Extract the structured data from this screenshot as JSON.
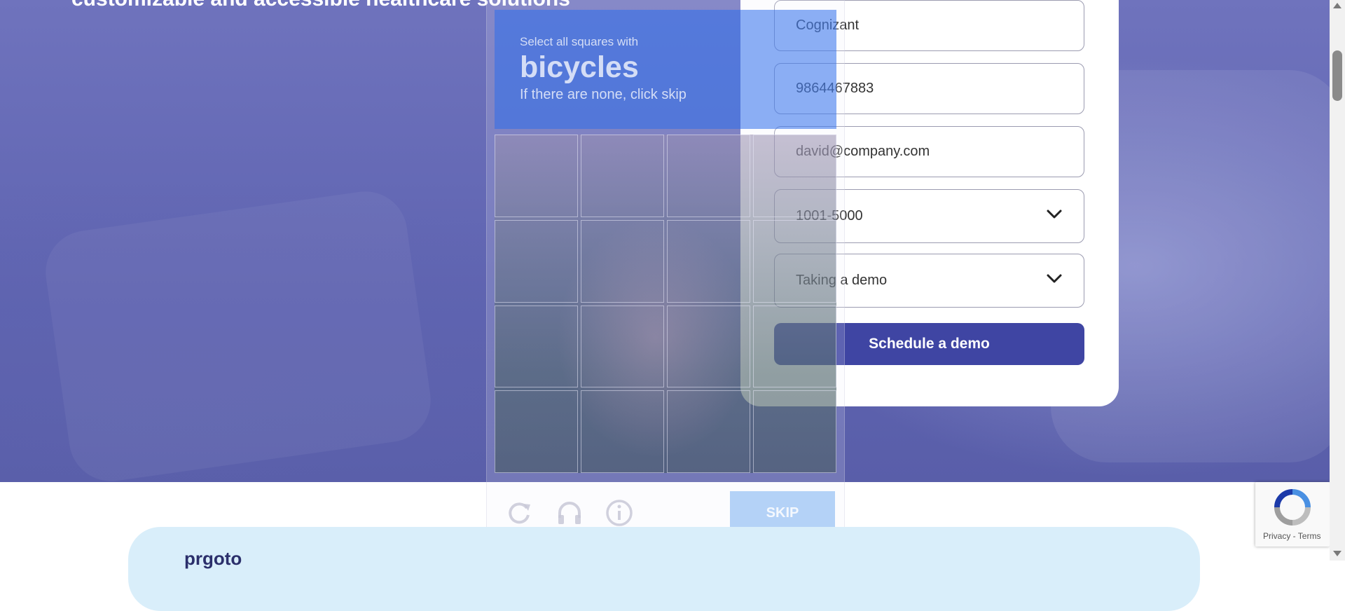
{
  "hero": {
    "title": "customizable and accessible healthcare solutions"
  },
  "form": {
    "company_value": "Cognizant",
    "phone_value": "9864467883",
    "email_value": "david@company.com",
    "company_size_selected": "1001-5000",
    "interest_selected": "Taking a demo",
    "submit_label": "Schedule a demo"
  },
  "captcha": {
    "instruction_line1": "Select all squares with",
    "target_object": "bicycles",
    "instruction_line3": "If there are none, click skip",
    "grid_rows": 4,
    "grid_cols": 4,
    "skip_label": "SKIP",
    "icons": [
      "reload-icon",
      "headphones-icon",
      "info-icon"
    ]
  },
  "lower": {
    "partial_text": "prgoto"
  },
  "recaptcha_badge": {
    "links_text": "Privacy - Terms"
  },
  "colors": {
    "hero_overlay": "#5f64b1",
    "submit_button": "#3f45a3",
    "captcha_header": "#2d6eeb",
    "skip_button": "#78aff0",
    "lower_band": "#d9eefa"
  }
}
